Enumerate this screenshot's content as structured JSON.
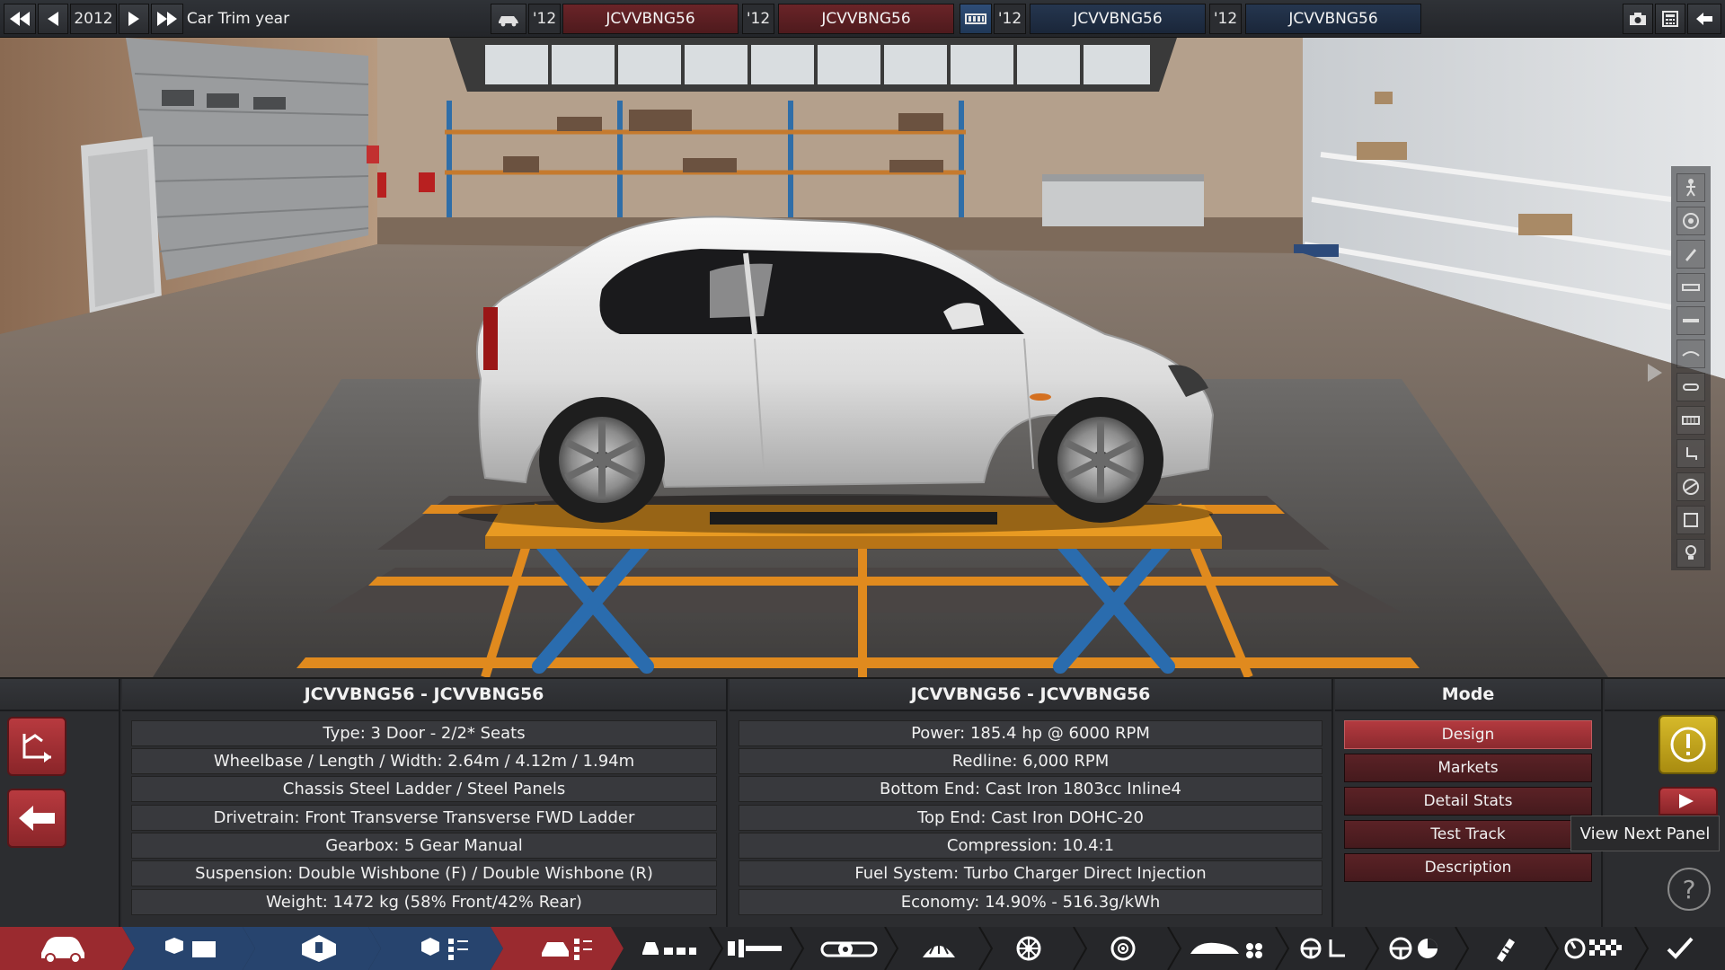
{
  "topbar": {
    "year": "2012",
    "trim_year_label": "Car Trim year",
    "slots": [
      {
        "year": "'12",
        "code": "JCVVBNG56"
      },
      {
        "year": "'12",
        "code": "JCVVBNG56"
      },
      {
        "year": "'12",
        "code": "JCVVBNG56"
      },
      {
        "year": "'12",
        "code": "JCVVBNG56"
      }
    ]
  },
  "left_panel": {
    "title": "JCVVBNG56 - JCVVBNG56",
    "rows": [
      "Type: 3 Door - 2/2* Seats",
      "Wheelbase / Length / Width: 2.64m / 4.12m / 1.94m",
      "Chassis Steel Ladder / Steel Panels",
      "Drivetrain: Front Transverse Transverse FWD Ladder",
      "Gearbox: 5 Gear Manual",
      "Suspension: Double Wishbone (F) / Double Wishbone (R)",
      "Weight: 1472 kg (58% Front/42% Rear)"
    ]
  },
  "right_panel": {
    "title": "JCVVBNG56 - JCVVBNG56",
    "rows": [
      "Power: 185.4 hp @ 6000 RPM",
      "Redline:  6,000 RPM",
      "Bottom End: Cast Iron 1803cc Inline4",
      "Top End: Cast Iron DOHC-20",
      "Compression: 10.4:1",
      "Fuel System: Turbo Charger Direct Injection",
      "Economy: 14.90% - 516.3g/kWh"
    ]
  },
  "mode": {
    "title": "Mode",
    "buttons": [
      "Design",
      "Markets",
      "Detail Stats",
      "Test Track",
      "Description"
    ]
  },
  "tooltip": "View Next Panel",
  "help": "?",
  "colors": {
    "accent_red": "#b33a3f",
    "slot_red": "#6a2428",
    "slot_blue": "#25364f",
    "gold": "#d6b92a",
    "nav_red": "#9a2a2f",
    "nav_blue": "#27446e"
  }
}
